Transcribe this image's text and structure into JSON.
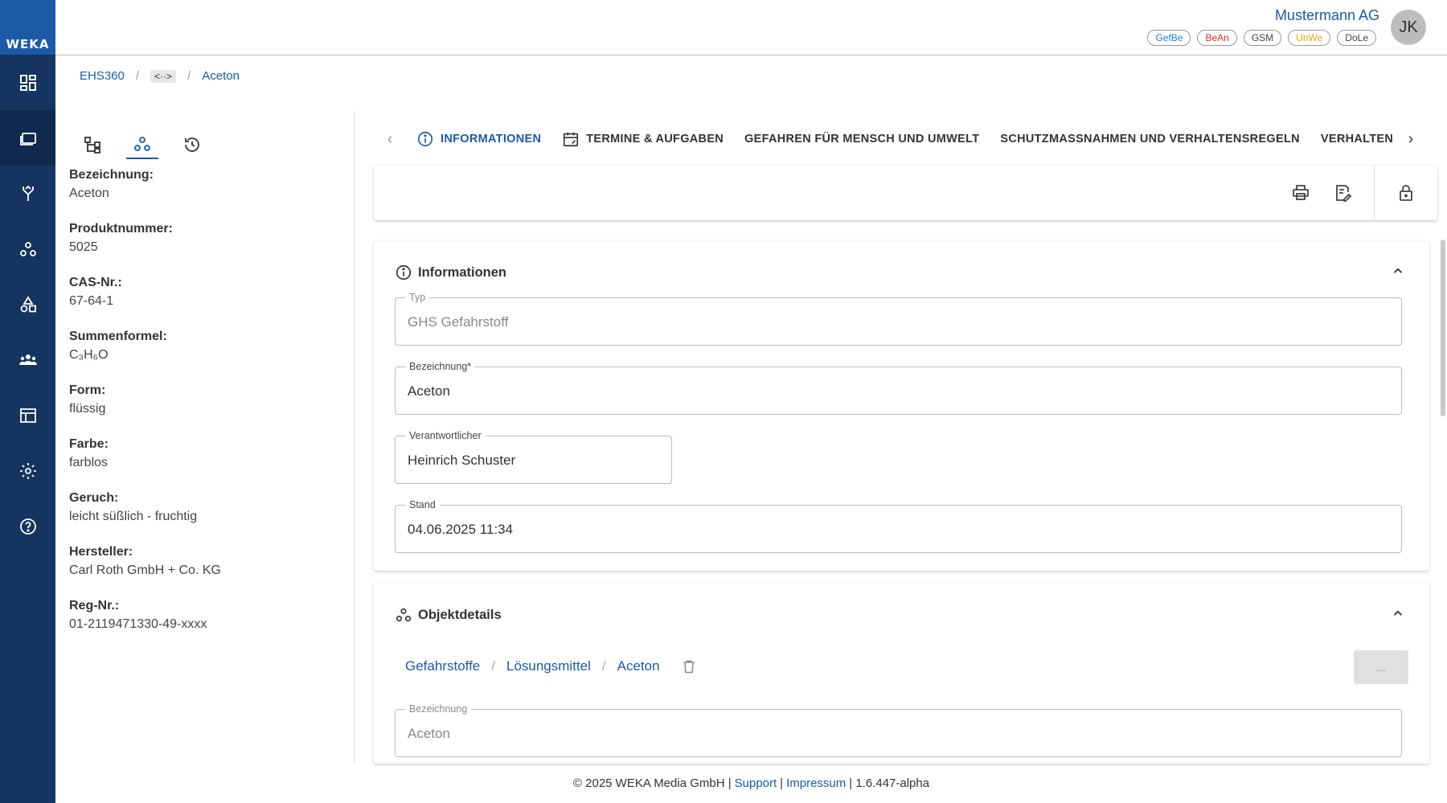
{
  "brand": {
    "logo_text": "WEKA"
  },
  "header": {
    "company": "Mustermann AG",
    "avatar_initials": "JK",
    "badges": [
      {
        "label": "GefBe",
        "color": "#1c7fd0"
      },
      {
        "label": "BeAn",
        "color": "#d0342c"
      },
      {
        "label": "GSM",
        "color": "#444444"
      },
      {
        "label": "UnWe",
        "color": "#e0a800"
      },
      {
        "label": "DoLe",
        "color": "#444444"
      }
    ]
  },
  "sidebar": {
    "items": [
      {
        "icon": "dashboard-icon"
      },
      {
        "icon": "folders-icon",
        "active": true
      },
      {
        "icon": "fork-icon"
      },
      {
        "icon": "objects-icon"
      },
      {
        "icon": "shapes-icon"
      },
      {
        "icon": "people-icon"
      },
      {
        "icon": "table-icon"
      },
      {
        "icon": "gear-icon"
      },
      {
        "icon": "help-icon"
      }
    ]
  },
  "breadcrumb": {
    "root": "EHS360",
    "code": "<··>",
    "current": "Aceton"
  },
  "left_panel": {
    "fields": [
      {
        "label": "Bezeichnung",
        "value": "Aceton"
      },
      {
        "label": "Produktnummer",
        "value": "5025"
      },
      {
        "label": "CAS-Nr.",
        "value": "67-64-1"
      },
      {
        "label": "Summenformel",
        "value": "C₃H₆O"
      },
      {
        "label": "Form",
        "value": "flüssig"
      },
      {
        "label": "Farbe",
        "value": "farblos"
      },
      {
        "label": "Geruch",
        "value": "leicht süßlich - fruchtig"
      },
      {
        "label": "Hersteller",
        "value": "Carl Roth GmbH + Co. KG"
      },
      {
        "label": "Reg-Nr.",
        "value": "01-2119471330-49-xxxx"
      }
    ]
  },
  "tabs": [
    {
      "label": "INFORMATIONEN",
      "icon": "info-icon",
      "active": true
    },
    {
      "label": "TERMINE & AUFGABEN",
      "icon": "calendar-icon"
    },
    {
      "label": "GEFAHREN FÜR MENSCH UND UMWELT"
    },
    {
      "label": "SCHUTZMASSNAHMEN UND VERHALTENSREGELN"
    },
    {
      "label": "VERHALTEN I"
    }
  ],
  "info_card": {
    "title": "Informationen",
    "typ": {
      "label": "Typ",
      "value": "GHS Gefahrstoff"
    },
    "bezeichnung": {
      "label": "Bezeichnung*",
      "value": "Aceton"
    },
    "verantwortlicher": {
      "label": "Verantwortlicher",
      "value": "Heinrich Schuster"
    },
    "stand": {
      "label": "Stand",
      "value": "04.06.2025 11:34"
    }
  },
  "object_card": {
    "title": "Objektdetails",
    "crumbs": [
      "Gefahrstoffe",
      "Lösungsmittel",
      "Aceton"
    ],
    "more_label": "...",
    "bezeichnung": {
      "label": "Bezeichnung",
      "value": "Aceton"
    }
  },
  "footer": {
    "copyright": "© 2025 WEKA Media GmbH |",
    "support": "Support",
    "sep": "|",
    "impressum": "Impressum",
    "version": "| 1.6.447-alpha"
  }
}
